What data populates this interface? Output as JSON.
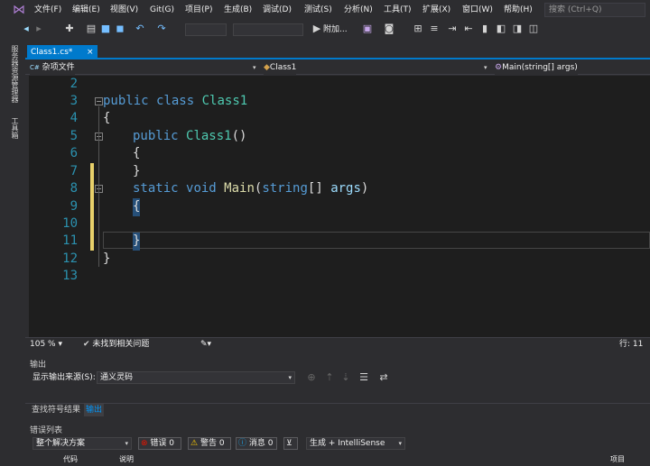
{
  "menu": [
    "文件(F)",
    "编辑(E)",
    "视图(V)",
    "Git(G)",
    "项目(P)",
    "生成(B)",
    "调试(D)",
    "测试(S)",
    "分析(N)",
    "工具(T)",
    "扩展(X)",
    "窗口(W)",
    "帮助(H)"
  ],
  "search_placeholder": "搜索 (Ctrl+Q)",
  "toolbar": {
    "run_label": "附加..."
  },
  "left_tabs": [
    "服务器资源管理器",
    "工具箱"
  ],
  "doc_tab": {
    "label": "Class1.cs*",
    "close": "×"
  },
  "nav": {
    "project": "杂项文件",
    "type": "Class1",
    "member": "Main(string[] args)"
  },
  "code_lines": [
    {
      "num": "2"
    },
    {
      "num": "3"
    },
    {
      "num": "4"
    },
    {
      "num": "5"
    },
    {
      "num": "6"
    },
    {
      "num": "7"
    },
    {
      "num": "8"
    },
    {
      "num": "9"
    },
    {
      "num": "10"
    },
    {
      "num": "11"
    },
    {
      "num": "12"
    },
    {
      "num": "13"
    }
  ],
  "code": {
    "l3a": "public",
    "l3b": "class",
    "l3c": "Class1",
    "l4": "{",
    "l5a": "public",
    "l5b": "Class1",
    "l5c": "()",
    "l6": "{",
    "l7": "}",
    "l8a": "static",
    "l8b": "void",
    "l8c": "Main",
    "l8d": "(",
    "l8e": "string",
    "l8f": "[] ",
    "l8g": "args",
    "l8h": ")",
    "l9": "{",
    "l11": "}",
    "l12": "}"
  },
  "editor_status": {
    "zoom": "105 %",
    "issues": "未找到相关问题",
    "line": "行: 11"
  },
  "output": {
    "title": "输出",
    "source_label": "显示输出来源(S):",
    "source_value": "通义灵码"
  },
  "bottom_tabs": [
    "查找符号结果",
    "输出"
  ],
  "errors": {
    "title": "错误列表",
    "scope": "整个解决方案",
    "errors": "错误 0",
    "warnings": "警告 0",
    "messages": "消息 0",
    "build": "生成 + IntelliSense",
    "col_code": "代码",
    "col_desc": "说明",
    "col_project": "项目"
  },
  "colors": {
    "accent": "#007acc",
    "keyword": "#569cd6",
    "type": "#4ec9b0",
    "method": "#dcdcaa",
    "param": "#9cdcfe",
    "linenum": "#2b91af"
  }
}
